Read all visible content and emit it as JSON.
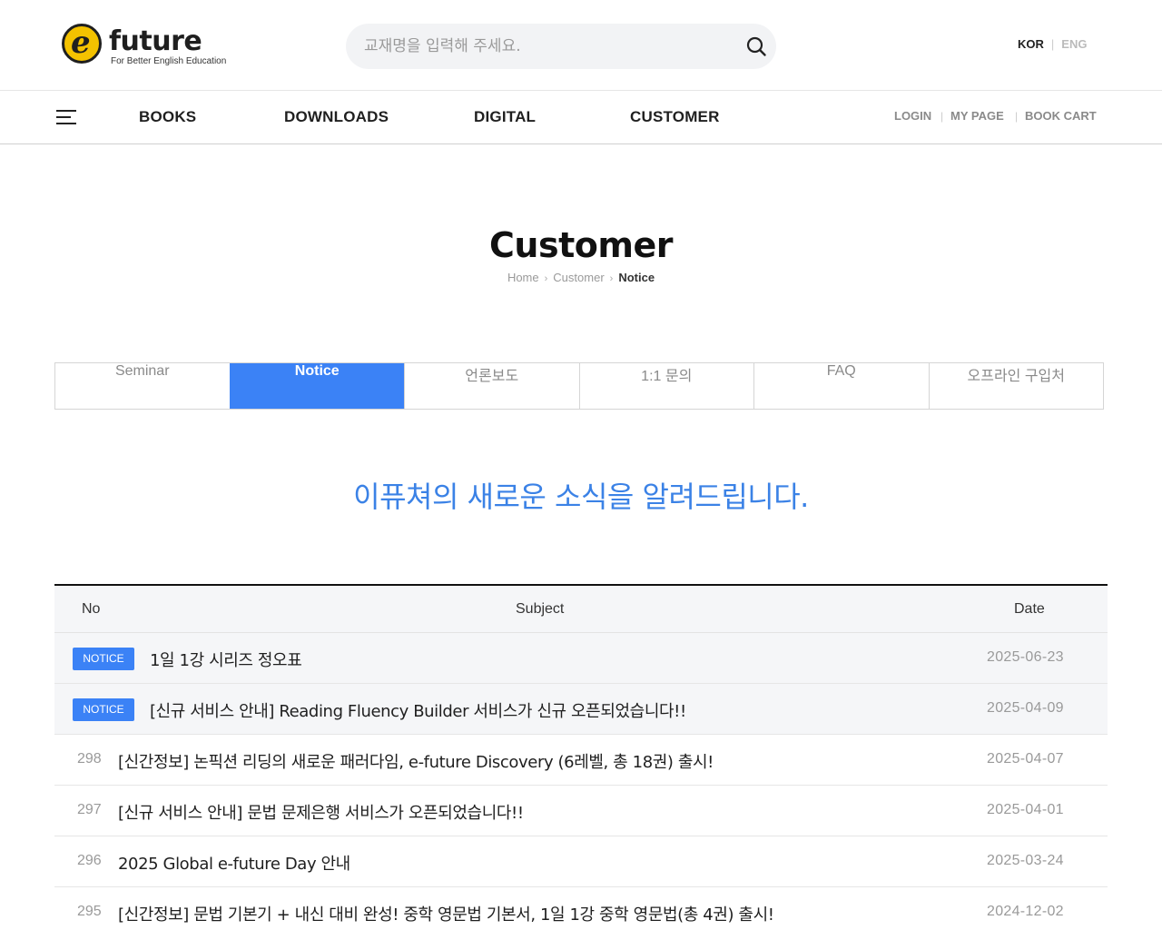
{
  "header": {
    "logo_text": "future",
    "logo_sub": "For Better English Education",
    "search_placeholder": "교재명을 입력해 주세요.",
    "lang_kor": "KOR",
    "lang_eng": "ENG"
  },
  "nav": {
    "items": [
      "BOOKS",
      "DOWNLOADS",
      "DIGITAL",
      "CUSTOMER"
    ],
    "util": [
      "LOGIN",
      "MY PAGE",
      "BOOK CART"
    ]
  },
  "page": {
    "title": "Customer",
    "breadcrumb": [
      "Home",
      "Customer",
      "Notice"
    ]
  },
  "tabs": [
    {
      "label": "Seminar",
      "active": false
    },
    {
      "label": "Notice",
      "active": true
    },
    {
      "label": "언론보도",
      "active": false
    },
    {
      "label": "1:1 문의",
      "active": false
    },
    {
      "label": "FAQ",
      "active": false
    },
    {
      "label": "오프라인 구입처",
      "active": false
    }
  ],
  "tagline": "이퓨쳐의 새로운 소식을 알려드립니다.",
  "table": {
    "headers": {
      "no": "No",
      "subject": "Subject",
      "date": "Date"
    },
    "rows": [
      {
        "no": "NOTICE",
        "subject": "1일 1강 시리즈 정오표",
        "date": "2025-06-23"
      },
      {
        "no": "NOTICE",
        "subject": "[신규 서비스 안내] Reading Fluency Builder 서비스가 신규 오픈되었습니다!!",
        "date": "2025-04-09"
      },
      {
        "no": "298",
        "subject": "[신간정보] 논픽션 리딩의 새로운 패러다임, e-future Discovery (6레벨, 총 18권) 출시!",
        "date": "2025-04-07"
      },
      {
        "no": "297",
        "subject": "[신규 서비스 안내] 문법 문제은행 서비스가 오픈되었습니다!!",
        "date": "2025-04-01"
      },
      {
        "no": "296",
        "subject": "2025 Global e-future Day 안내",
        "date": "2025-03-24"
      },
      {
        "no": "295",
        "subject": "[신간정보] 문법 기본기 + 내신 대비 완성! 중학 영문법 기본서, 1일 1강 중학 영문법(총 4권) 출시!",
        "date": "2024-12-02"
      }
    ]
  },
  "colors": {
    "accent": "#3b82f6",
    "logo_yellow": "#f4c200",
    "title_highlight": "#fff59a",
    "tagline": "#3b82e6"
  }
}
